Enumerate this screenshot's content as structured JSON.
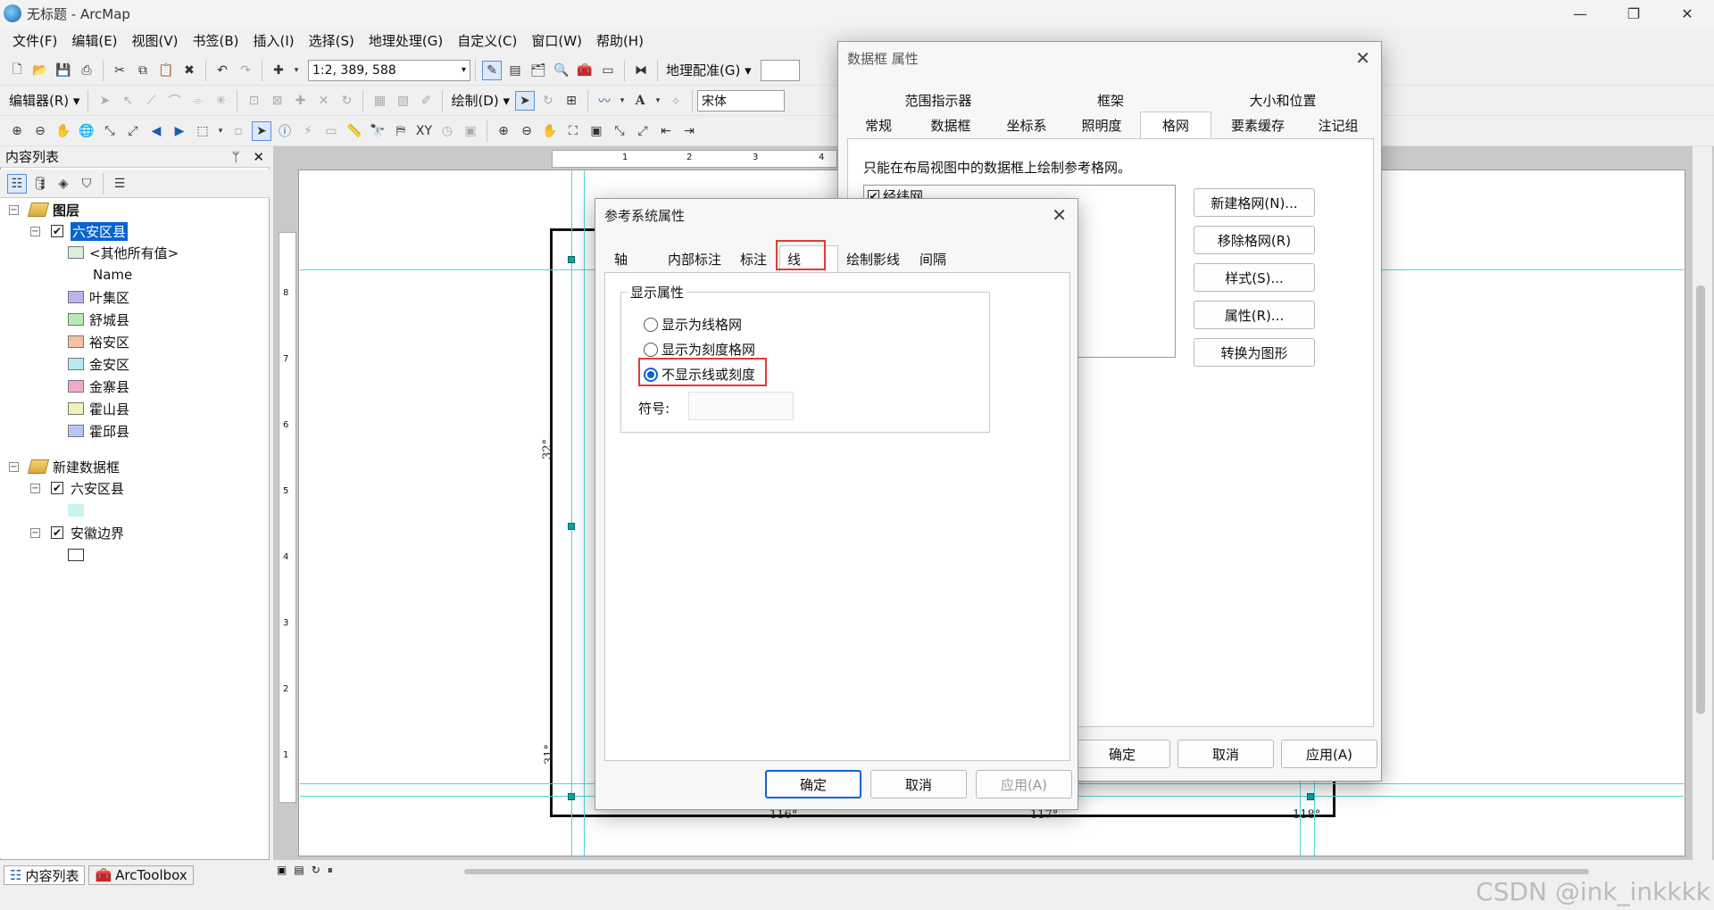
{
  "window": {
    "title": "无标题 - ArcMap",
    "minimize": "—",
    "maximize": "❐",
    "close": "✕"
  },
  "menu": [
    "文件(F)",
    "编辑(E)",
    "视图(V)",
    "书签(B)",
    "插入(I)",
    "选择(S)",
    "地理处理(G)",
    "自定义(C)",
    "窗口(W)",
    "帮助(H)"
  ],
  "toolbar": {
    "scale": "1:2, 389, 588",
    "georef": "地理配准(G)",
    "editor": "编辑器(R)",
    "draw": "绘制(D)",
    "font": "宋体"
  },
  "toc": {
    "title": "内容列表",
    "pin": "ᛘ",
    "close": "✕",
    "tree": {
      "layers_group": "图层",
      "layer1": "六安区县",
      "other_values": "<其他所有值>",
      "field": "Name",
      "classes": [
        {
          "label": "叶集区",
          "color": "#b9b4f0"
        },
        {
          "label": "舒城县",
          "color": "#b7ecb0"
        },
        {
          "label": "裕安区",
          "color": "#f5c0a6"
        },
        {
          "label": "金安区",
          "color": "#b7e9f0"
        },
        {
          "label": "金寨县",
          "color": "#f3a9cf"
        },
        {
          "label": "霍山县",
          "color": "#f1f0b5"
        },
        {
          "label": "霍邱县",
          "color": "#b7c7f3"
        }
      ],
      "other_swatch": "#d9f1d6",
      "new_frame": "新建数据框",
      "frame_layer1": "六安区县",
      "frame_layer1_swatch": "#c8f3ef",
      "frame_layer2": "安徽边界"
    },
    "bottom_tabs": [
      "内容列表",
      "ArcToolbox"
    ]
  },
  "map": {
    "coords": {
      "x116": "116°",
      "x117": "117°",
      "x118": "118°",
      "y32": "32°",
      "y31": "31°"
    },
    "ruler_h": [
      "1",
      "2",
      "3",
      "4"
    ],
    "ruler_v": [
      "8",
      "7",
      "6",
      "5",
      "4",
      "3",
      "2",
      "1"
    ]
  },
  "dataframe_dialog": {
    "title": "数据框 属性",
    "tabs_row1": [
      "范围指示器",
      "框架",
      "大小和位置"
    ],
    "tabs_row2": [
      "常规",
      "数据框",
      "坐标系",
      "照明度",
      "格网",
      "要素缓存",
      "注记组"
    ],
    "active_tab": "格网",
    "note": "只能在布局视图中的数据框上绘制参考格网。",
    "grid_item": "经纬网",
    "buttons": [
      "新建格网(N)...",
      "移除格网(R)",
      "样式(S)...",
      "属性(R)...",
      "转换为图形"
    ],
    "ok": "确定",
    "cancel": "取消",
    "apply": "应用(A)"
  },
  "ref_dialog": {
    "title": "参考系统属性",
    "tabs": [
      "轴",
      "内部标注",
      "标注",
      "线",
      "绘制影线",
      "间隔"
    ],
    "active_tab": "线",
    "group_title": "显示属性",
    "options": [
      "显示为线格网",
      "显示为刻度格网",
      "不显示线或刻度"
    ],
    "selected_option": "不显示线或刻度",
    "symbol_label": "符号:",
    "ok": "确定",
    "cancel": "取消",
    "apply": "应用(A)"
  },
  "watermark": "CSDN @ink_inkkkk",
  "colors": {
    "accent": "#0a64d0",
    "highlight_red": "#e53935",
    "guide": "#57d3d3"
  }
}
